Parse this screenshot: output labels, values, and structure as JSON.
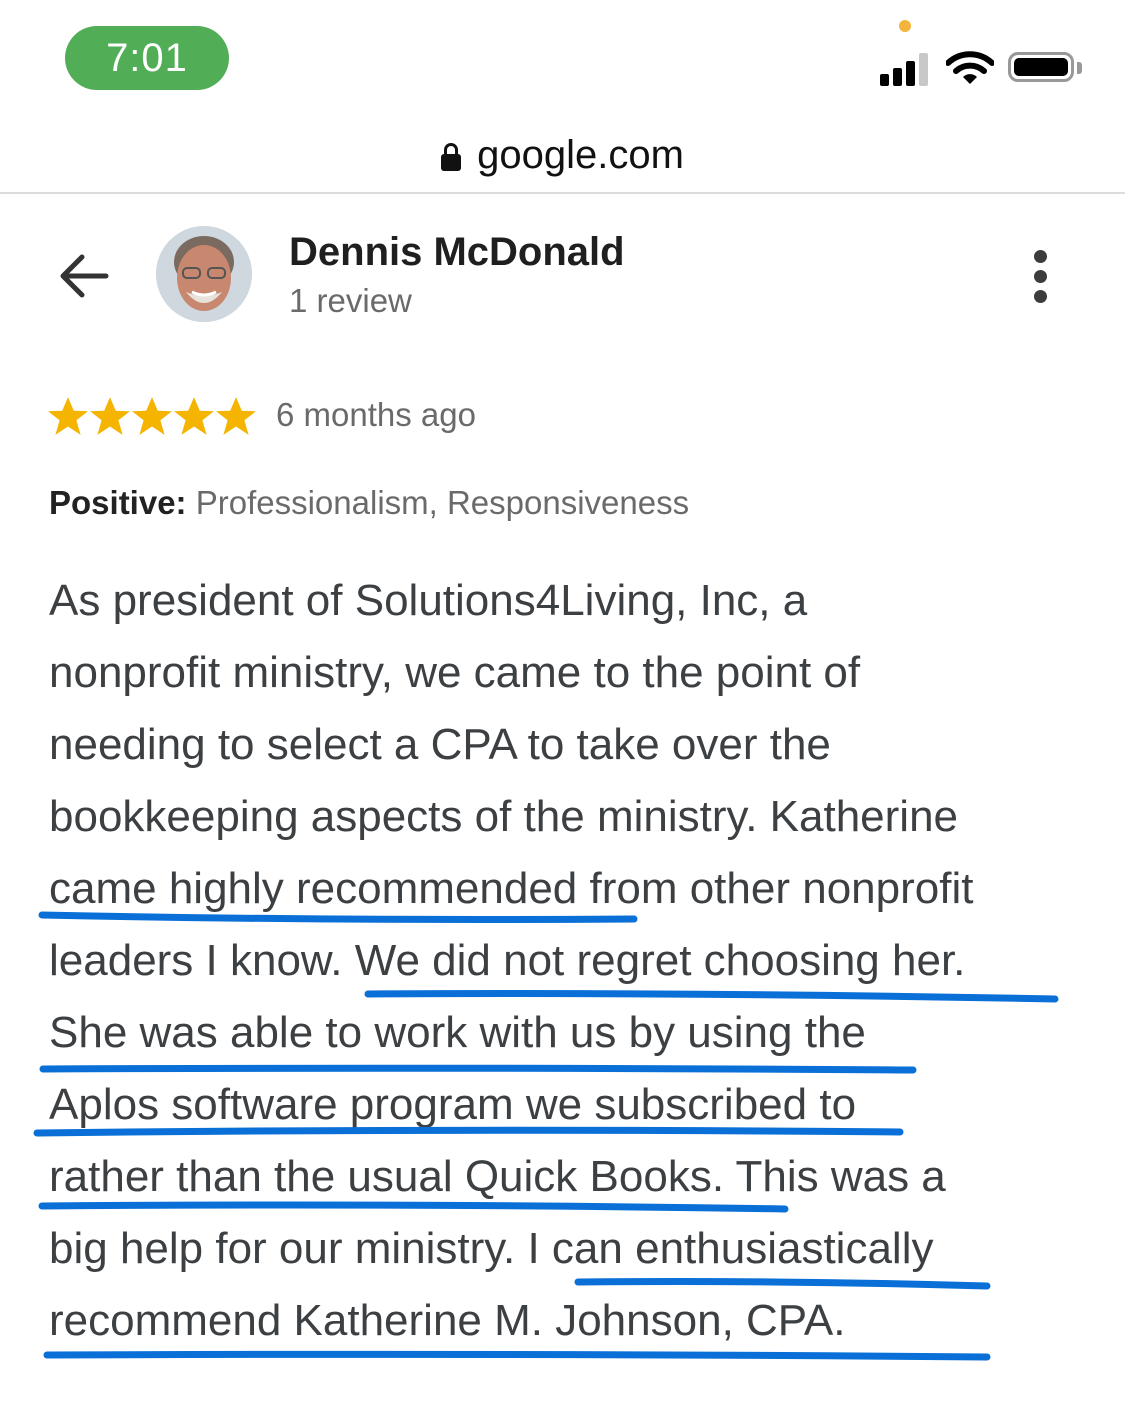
{
  "status_bar": {
    "time": "7:01"
  },
  "url_bar": {
    "domain": "google.com",
    "lock_icon": "lock-icon"
  },
  "header": {
    "back_icon": "arrow-back-icon",
    "reviewer_name": "Dennis McDonald",
    "review_count": "1 review",
    "more_icon": "more-vertical-icon"
  },
  "rating": {
    "stars": 5,
    "max_stars": 5,
    "star_color": "#f4b400",
    "time_ago": "6 months ago"
  },
  "positive": {
    "label": "Positive:",
    "value": "Professionalism, Responsiveness"
  },
  "review": {
    "lines": [
      "As president of Solutions4Living, Inc, a",
      "nonprofit ministry, we came to the point of",
      "needing to select a CPA to take over the",
      "bookkeeping aspects of the ministry. Katherine",
      "came highly recommended from other nonprofit",
      "leaders I know. We did not regret choosing her.",
      "She was able to work with us by using the",
      "Aplos software program we subscribed to",
      "rather than the usual Quick Books. This was a",
      "big help for our ministry. I can enthusiastically",
      "recommend Katherine M. Johnson, CPA."
    ],
    "underline_color": "#0a6fd6"
  }
}
